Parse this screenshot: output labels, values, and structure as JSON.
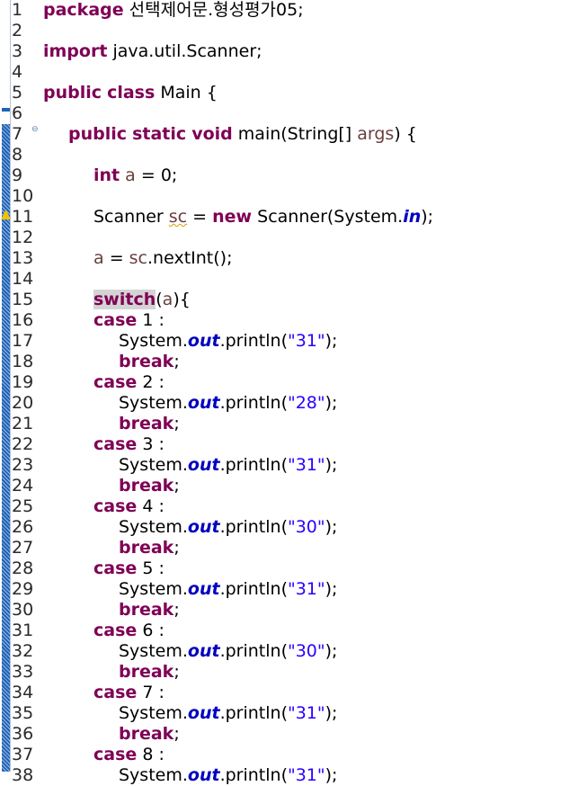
{
  "gutter": {
    "fold_icon": "collapse-minus-icon",
    "warning_icon": "warning-triangle-icon",
    "change_bar_color": "#1f63b8"
  },
  "colors": {
    "keyword": "#7f0055",
    "string": "#2a00ff",
    "static_field": "#0000c0",
    "local_variable": "#6a3e3e"
  },
  "lines": [
    {
      "n": "1",
      "indent": 0,
      "t": [
        {
          "k": "kw",
          "v": "package"
        },
        {
          "v": " 선택제어문.형성평가05;"
        }
      ]
    },
    {
      "n": "2",
      "indent": 0,
      "t": []
    },
    {
      "n": "3",
      "indent": 0,
      "t": [
        {
          "k": "kw",
          "v": "import"
        },
        {
          "v": " java.util.Scanner;"
        }
      ]
    },
    {
      "n": "4",
      "indent": 0,
      "t": []
    },
    {
      "n": "5",
      "indent": 0,
      "t": [
        {
          "k": "kw",
          "v": "public"
        },
        {
          "v": " "
        },
        {
          "k": "kw",
          "v": "class"
        },
        {
          "v": " Main {"
        }
      ]
    },
    {
      "n": "6",
      "indent": 0,
      "t": []
    },
    {
      "n": "7",
      "indent": 1,
      "fold": true,
      "t": [
        {
          "k": "kw",
          "v": "public"
        },
        {
          "v": " "
        },
        {
          "k": "kw",
          "v": "static"
        },
        {
          "v": " "
        },
        {
          "k": "kw",
          "v": "void"
        },
        {
          "v": " main(String[] "
        },
        {
          "k": "var",
          "v": "args"
        },
        {
          "v": ") {"
        }
      ]
    },
    {
      "n": "8",
      "indent": 0,
      "t": []
    },
    {
      "n": "9",
      "indent": 2,
      "t": [
        {
          "k": "kw",
          "v": "int"
        },
        {
          "v": " "
        },
        {
          "k": "var",
          "v": "a"
        },
        {
          "v": " = 0;"
        }
      ]
    },
    {
      "n": "10",
      "indent": 0,
      "t": []
    },
    {
      "n": "11",
      "indent": 2,
      "warn": true,
      "t": [
        {
          "v": "Scanner "
        },
        {
          "k": "var squiggle",
          "v": "sc"
        },
        {
          "v": " = "
        },
        {
          "k": "kw",
          "v": "new"
        },
        {
          "v": " Scanner(System."
        },
        {
          "k": "fld",
          "v": "in"
        },
        {
          "v": ");"
        }
      ]
    },
    {
      "n": "12",
      "indent": 0,
      "t": []
    },
    {
      "n": "13",
      "indent": 2,
      "t": [
        {
          "k": "var",
          "v": "a"
        },
        {
          "v": " = "
        },
        {
          "k": "var",
          "v": "sc"
        },
        {
          "v": ".nextInt();"
        }
      ]
    },
    {
      "n": "14",
      "indent": 0,
      "t": []
    },
    {
      "n": "15",
      "indent": 2,
      "t": [
        {
          "k": "kw hl",
          "v": "switch"
        },
        {
          "v": "("
        },
        {
          "k": "var",
          "v": "a"
        },
        {
          "v": "){"
        }
      ]
    },
    {
      "n": "16",
      "indent": 2,
      "t": [
        {
          "k": "kw",
          "v": "case"
        },
        {
          "v": " 1 :"
        }
      ]
    },
    {
      "n": "17",
      "indent": 3,
      "t": [
        {
          "v": "System."
        },
        {
          "k": "fld",
          "v": "out"
        },
        {
          "v": ".println("
        },
        {
          "k": "str",
          "v": "\"31\""
        },
        {
          "v": ");"
        }
      ]
    },
    {
      "n": "18",
      "indent": 3,
      "t": [
        {
          "k": "kw",
          "v": "break"
        },
        {
          "v": ";"
        }
      ]
    },
    {
      "n": "19",
      "indent": 2,
      "t": [
        {
          "k": "kw",
          "v": "case"
        },
        {
          "v": " 2 :"
        }
      ]
    },
    {
      "n": "20",
      "indent": 3,
      "t": [
        {
          "v": "System."
        },
        {
          "k": "fld",
          "v": "out"
        },
        {
          "v": ".println("
        },
        {
          "k": "str",
          "v": "\"28\""
        },
        {
          "v": ");"
        }
      ]
    },
    {
      "n": "21",
      "indent": 3,
      "t": [
        {
          "k": "kw",
          "v": "break"
        },
        {
          "v": ";"
        }
      ]
    },
    {
      "n": "22",
      "indent": 2,
      "t": [
        {
          "k": "kw",
          "v": "case"
        },
        {
          "v": " 3 :"
        }
      ]
    },
    {
      "n": "23",
      "indent": 3,
      "t": [
        {
          "v": "System."
        },
        {
          "k": "fld",
          "v": "out"
        },
        {
          "v": ".println("
        },
        {
          "k": "str",
          "v": "\"31\""
        },
        {
          "v": ");"
        }
      ]
    },
    {
      "n": "24",
      "indent": 3,
      "t": [
        {
          "k": "kw",
          "v": "break"
        },
        {
          "v": ";"
        }
      ]
    },
    {
      "n": "25",
      "indent": 2,
      "t": [
        {
          "k": "kw",
          "v": "case"
        },
        {
          "v": " 4 :"
        }
      ]
    },
    {
      "n": "26",
      "indent": 3,
      "t": [
        {
          "v": "System."
        },
        {
          "k": "fld",
          "v": "out"
        },
        {
          "v": ".println("
        },
        {
          "k": "str",
          "v": "\"30\""
        },
        {
          "v": ");"
        }
      ]
    },
    {
      "n": "27",
      "indent": 3,
      "t": [
        {
          "k": "kw",
          "v": "break"
        },
        {
          "v": ";"
        }
      ]
    },
    {
      "n": "28",
      "indent": 2,
      "t": [
        {
          "k": "kw",
          "v": "case"
        },
        {
          "v": " 5 :"
        }
      ]
    },
    {
      "n": "29",
      "indent": 3,
      "t": [
        {
          "v": "System."
        },
        {
          "k": "fld",
          "v": "out"
        },
        {
          "v": ".println("
        },
        {
          "k": "str",
          "v": "\"31\""
        },
        {
          "v": ");"
        }
      ]
    },
    {
      "n": "30",
      "indent": 3,
      "t": [
        {
          "k": "kw",
          "v": "break"
        },
        {
          "v": ";"
        }
      ]
    },
    {
      "n": "31",
      "indent": 2,
      "t": [
        {
          "k": "kw",
          "v": "case"
        },
        {
          "v": " 6 :"
        }
      ]
    },
    {
      "n": "32",
      "indent": 3,
      "t": [
        {
          "v": "System."
        },
        {
          "k": "fld",
          "v": "out"
        },
        {
          "v": ".println("
        },
        {
          "k": "str",
          "v": "\"30\""
        },
        {
          "v": ");"
        }
      ]
    },
    {
      "n": "33",
      "indent": 3,
      "t": [
        {
          "k": "kw",
          "v": "break"
        },
        {
          "v": ";"
        }
      ]
    },
    {
      "n": "34",
      "indent": 2,
      "t": [
        {
          "k": "kw",
          "v": "case"
        },
        {
          "v": " 7 :"
        }
      ]
    },
    {
      "n": "35",
      "indent": 3,
      "t": [
        {
          "v": "System."
        },
        {
          "k": "fld",
          "v": "out"
        },
        {
          "v": ".println("
        },
        {
          "k": "str",
          "v": "\"31\""
        },
        {
          "v": ");"
        }
      ]
    },
    {
      "n": "36",
      "indent": 3,
      "t": [
        {
          "k": "kw",
          "v": "break"
        },
        {
          "v": ";"
        }
      ]
    },
    {
      "n": "37",
      "indent": 2,
      "t": [
        {
          "k": "kw",
          "v": "case"
        },
        {
          "v": " 8 :"
        }
      ]
    },
    {
      "n": "38",
      "indent": 3,
      "t": [
        {
          "v": "System."
        },
        {
          "k": "fld",
          "v": "out"
        },
        {
          "v": ".println("
        },
        {
          "k": "str",
          "v": "\"31\""
        },
        {
          "v": ");"
        }
      ]
    }
  ]
}
